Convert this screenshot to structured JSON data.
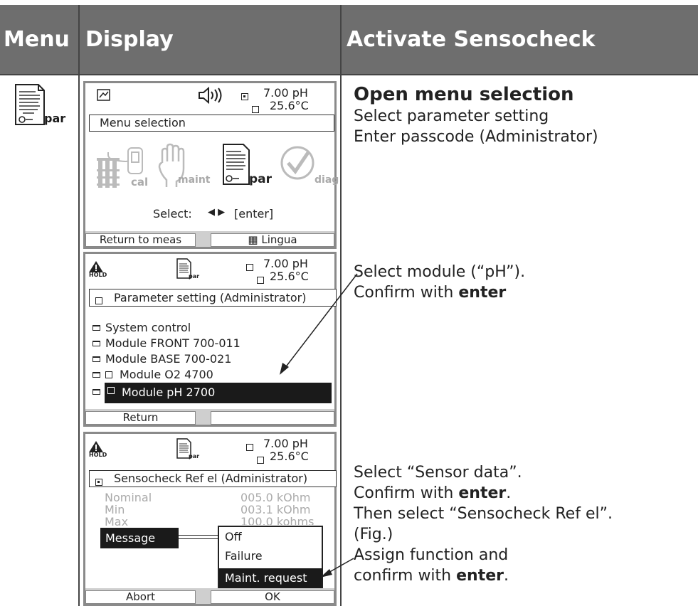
{
  "header": {
    "col_menu": "Menu",
    "col_display": "Display",
    "col_activate": "Activate Sensocheck"
  },
  "menu_icon": {
    "label": "par"
  },
  "screen1": {
    "ph": "7.00 pH",
    "temp": "25.6°C",
    "title": "Menu selection",
    "icons": {
      "cal": "cal",
      "maint": "maint",
      "par": "par",
      "diag": "diag"
    },
    "select_label": "Select:",
    "select_hint": "[enter]",
    "softkey_left": "Return to meas",
    "softkey_right": "Lingua"
  },
  "screen2": {
    "hold": "HOLD",
    "par": "par",
    "ph": "7.00 pH",
    "temp": "25.6°C",
    "title": "Parameter setting (Administrator)",
    "items": [
      "System control",
      "Module FRONT 700-011",
      "Module BASE 700-021",
      "Module O2 4700",
      "Module pH 2700"
    ],
    "softkey_left": "Return"
  },
  "screen3": {
    "hold": "HOLD",
    "par": "par",
    "ph": "7.00 pH",
    "temp": "25.6°C",
    "title": "Sensocheck Ref el (Administrator)",
    "rows": [
      {
        "label": "Nominal",
        "value": "005.0 kOhm"
      },
      {
        "label": "Min",
        "value": "003.1 kOhm"
      },
      {
        "label": "Max",
        "value": "100.0 kohms"
      }
    ],
    "message_label": "Message",
    "options": [
      "Off",
      "Failure",
      "Maint. request"
    ],
    "softkey_left": "Abort",
    "softkey_right": "OK"
  },
  "instructions": {
    "block1": {
      "heading": "Open menu selection",
      "line1": "Select parameter setting",
      "line2": "Enter passcode (Administrator)"
    },
    "block2": {
      "line1": "Select module (“pH”).",
      "line2_prefix": "Confirm with ",
      "line2_bold": "enter"
    },
    "block3": {
      "line1": "Select “Sensor data”.",
      "line2_prefix": "Confirm with ",
      "line2_bold": "enter",
      "line2_suffix": ".",
      "line3": "Then select “Sensocheck Ref el”.",
      "line4": "(Fig.)",
      "line5": "Assign function and",
      "line6_prefix": "confirm with ",
      "line6_bold": "enter",
      "line6_suffix": "."
    }
  }
}
